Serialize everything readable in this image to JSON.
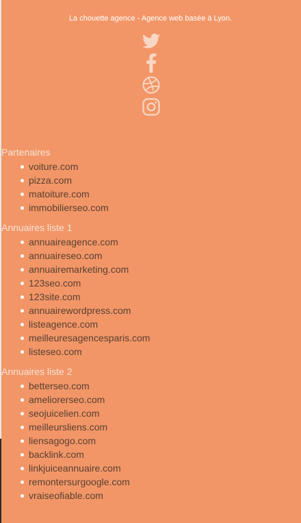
{
  "footer": {
    "tagline": "La chouette agence - Agence web basée à Lyon.",
    "social": [
      {
        "icon": "twitter-icon"
      },
      {
        "icon": "facebook-icon"
      },
      {
        "icon": "dribbble-icon"
      },
      {
        "icon": "instagram-icon"
      }
    ]
  },
  "sections": [
    {
      "title": "Partenaires",
      "links": [
        "voiture.com",
        "pizza.com",
        "matoiture.com",
        "immobilierseo.com"
      ]
    },
    {
      "title": "Annuaires liste 1",
      "links": [
        "annuaireagence.com",
        "annuaireseo.com",
        "annuairemarketing.com",
        "123seo.com",
        "123site.com",
        "annuairewordpress.com",
        "listeagence.com",
        "meilleuresagencesparis.com",
        "listeseo.com"
      ]
    },
    {
      "title": "Annuaires liste 2",
      "links": [
        "betterseo.com",
        "ameliorerseo.com",
        "seojuicelien.com",
        "meilleursliens.com",
        "liensagogo.com",
        "backlink.com",
        "linkjuiceannuaire.com",
        "remontersurgoogle.com",
        "vraiseofiable.com"
      ]
    }
  ],
  "colors": {
    "background": "#f29668",
    "icon": "#f8d8c4",
    "link_text": "#5a4030",
    "section_title": "#f6e3d4"
  }
}
